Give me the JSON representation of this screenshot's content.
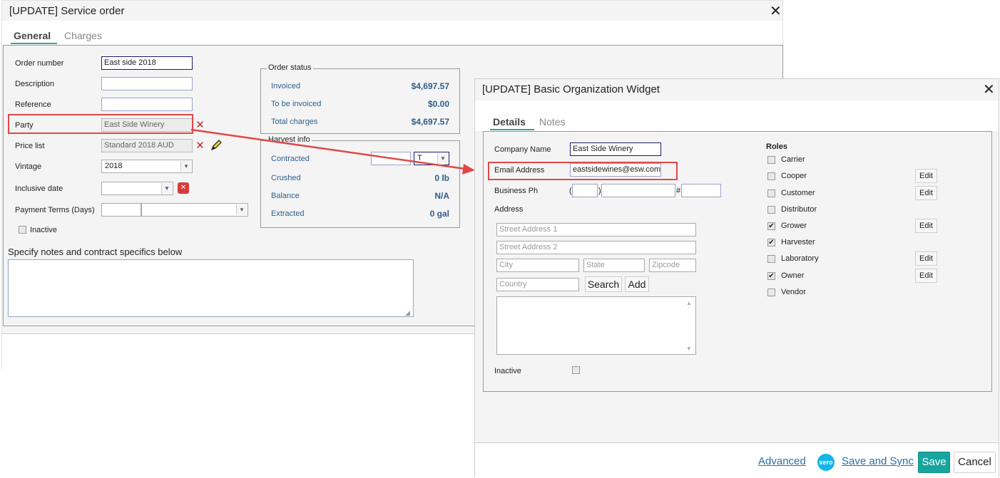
{
  "service_order": {
    "title": "[UPDATE] Service order",
    "tabs": [
      {
        "label": "General",
        "active": true
      },
      {
        "label": "Charges",
        "active": false
      }
    ],
    "fields": {
      "order_number": {
        "label": "Order number",
        "value": "East side 2018"
      },
      "description": {
        "label": "Description",
        "value": ""
      },
      "reference": {
        "label": "Reference",
        "value": ""
      },
      "party": {
        "label": "Party",
        "value": "East Side Winery"
      },
      "price_list": {
        "label": "Price list",
        "value": "Standard 2018 AUD"
      },
      "vintage": {
        "label": "Vintage",
        "value": "2018"
      },
      "inclusive_date": {
        "label": "Inclusive date",
        "value": ""
      },
      "payment_terms": {
        "label": "Payment Terms (Days)",
        "value": "",
        "option": ""
      },
      "inactive": {
        "label": "Inactive",
        "checked": false
      }
    },
    "order_status": {
      "legend": "Order status",
      "rows": [
        {
          "label": "Invoiced",
          "value": "$4,697.57"
        },
        {
          "label": "To be invoiced",
          "value": "$0.00"
        },
        {
          "label": "Total charges",
          "value": "$4,697.57"
        }
      ]
    },
    "harvest_info": {
      "legend": "Harvest info",
      "contracted_label": "Contracted",
      "contracted_value": "",
      "unit_option": "T",
      "rows": [
        {
          "label": "Crushed",
          "value": "0 lb"
        },
        {
          "label": "Balance",
          "value": "N/A"
        },
        {
          "label": "Extracted",
          "value": "0 gal"
        }
      ]
    },
    "notes_label": "Specify notes and contract specifics below",
    "notes_value": ""
  },
  "org_widget": {
    "title": "[UPDATE] Basic Organization Widget",
    "tabs": [
      {
        "label": "Details",
        "active": true
      },
      {
        "label": "Notes",
        "active": false
      }
    ],
    "company_name": {
      "label": "Company Name",
      "value": "East Side Winery"
    },
    "email": {
      "label": "Email Address",
      "value": "eastsidewines@esw.com"
    },
    "business_ph": {
      "label": "Business Ph",
      "area": "",
      "number": "",
      "ext_symbol": "#",
      "ext": ""
    },
    "address": {
      "label": "Address",
      "street1_placeholder": "Street Address 1",
      "street2_placeholder": "Street Address 2",
      "city_placeholder": "City",
      "state_placeholder": "State",
      "zip_placeholder": "Zipcode",
      "country_placeholder": "Country",
      "search_label": "Search",
      "add_label": "Add"
    },
    "inactive": {
      "label": "Inactive",
      "checked": false
    },
    "roles": {
      "title": "Roles",
      "edit_label": "Edit",
      "items": [
        {
          "label": "Carrier",
          "checked": false,
          "editable": false
        },
        {
          "label": "Cooper",
          "checked": false,
          "editable": true
        },
        {
          "label": "Customer",
          "checked": false,
          "editable": true
        },
        {
          "label": "Distributor",
          "checked": false,
          "editable": false
        },
        {
          "label": "Grower",
          "checked": true,
          "editable": true
        },
        {
          "label": "Harvester",
          "checked": true,
          "editable": false
        },
        {
          "label": "Laboratory",
          "checked": false,
          "editable": true
        },
        {
          "label": "Owner",
          "checked": true,
          "editable": true
        },
        {
          "label": "Vendor",
          "checked": false,
          "editable": false
        }
      ]
    },
    "footer": {
      "advanced_label": "Advanced",
      "xero_badge": "xero",
      "save_sync_label": "Save and Sync",
      "save_label": "Save",
      "cancel_label": "Cancel"
    }
  },
  "colors": {
    "accent": "#17a5a0",
    "highlight": "#e04848",
    "stat_text": "#2f5e8c"
  }
}
